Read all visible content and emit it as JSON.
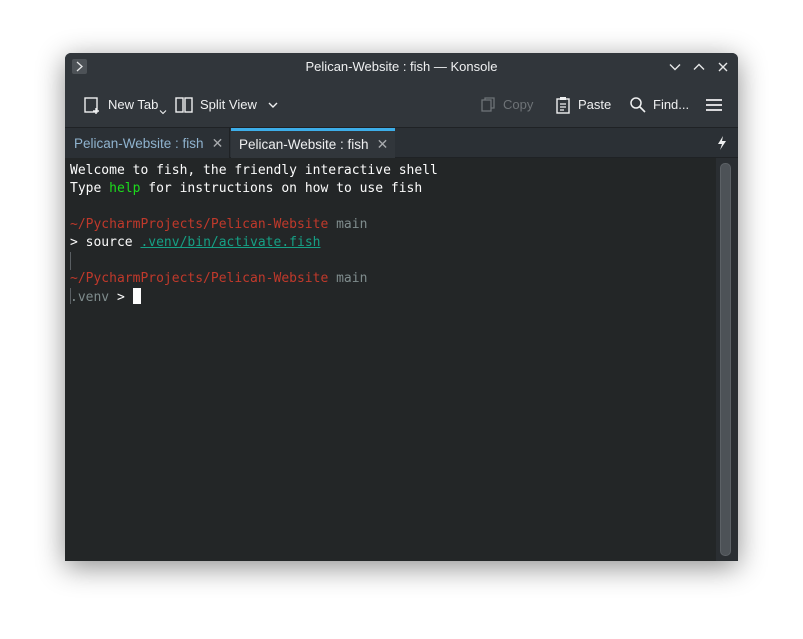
{
  "window": {
    "title": "Pelican-Website : fish — Konsole"
  },
  "toolbar": {
    "new_tab": "New Tab",
    "split_view": "Split View",
    "copy": "Copy",
    "paste": "Paste",
    "find": "Find..."
  },
  "tabs": [
    {
      "label": "Pelican-Website : fish",
      "active": false
    },
    {
      "label": "Pelican-Website : fish",
      "active": true
    }
  ],
  "terminal": {
    "welcome_line": "Welcome to fish, the friendly interactive shell",
    "help_prefix": "Type ",
    "help_word": "help",
    "help_suffix": " for instructions on how to use fish",
    "prompt1_path": "~/PycharmProjects/Pelican-Website",
    "prompt1_branch": " main",
    "cmd1_prompt": "> ",
    "cmd1_text": "source ",
    "cmd1_arg": ".venv/bin/activate.fish",
    "prompt2_path": "~/PycharmProjects/Pelican-Website",
    "prompt2_branch": " main",
    "venv_label": ".venv",
    "cmd2_prompt": " > "
  },
  "colors": {
    "accent": "#3daee9",
    "path_red": "#c0392b",
    "help_green": "#1cdc1c",
    "link_teal": "#16a085",
    "terminal_bg": "#232627"
  }
}
